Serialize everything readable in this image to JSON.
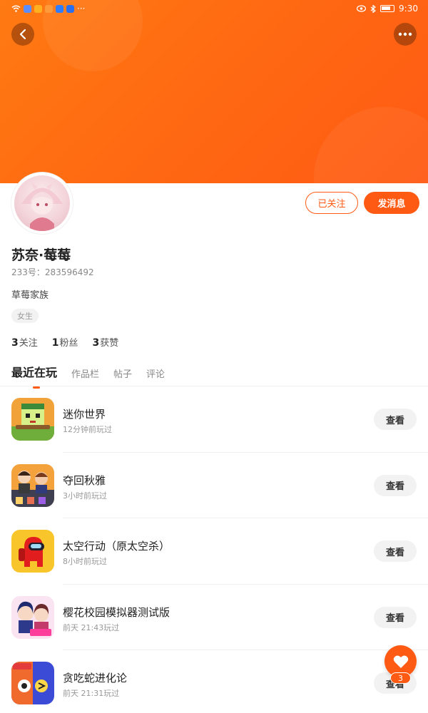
{
  "status_bar": {
    "time": "9:30",
    "app_icons": [
      "wifi-icon",
      "browser-app-icon",
      "shop-app-icon",
      "video-app-icon",
      "download-app-icon",
      "search-app-icon"
    ],
    "more": "···"
  },
  "profile": {
    "name": "苏奈·莓莓",
    "uid": "233号：283596492",
    "bio": "草莓家族",
    "gender_tag": "女生",
    "follow_button": "已关注",
    "message_button": "发消息"
  },
  "stats": [
    {
      "count": "3",
      "label": "关注"
    },
    {
      "count": "1",
      "label": "粉丝"
    },
    {
      "count": "3",
      "label": "获赞"
    }
  ],
  "tabs": [
    "最近在玩",
    "作品栏",
    "帖子",
    "评论"
  ],
  "games": [
    {
      "title": "迷你世界",
      "time": "12分钟前玩过",
      "button": "查看"
    },
    {
      "title": "夺回秋雅",
      "time": "3小时前玩过",
      "button": "查看"
    },
    {
      "title": "太空行动（原太空杀）",
      "time": "8小时前玩过",
      "button": "查看"
    },
    {
      "title": "樱花校园模拟器测试版",
      "time": "前天 21:43玩过",
      "button": "查看"
    },
    {
      "title": "贪吃蛇进化论",
      "time": "前天 21:31玩过",
      "button": "查看"
    }
  ],
  "fab": {
    "badge": "3",
    "icon": "heart-icon"
  },
  "colors": {
    "accent": "#ff5a14",
    "banner": "#ff7a12"
  }
}
